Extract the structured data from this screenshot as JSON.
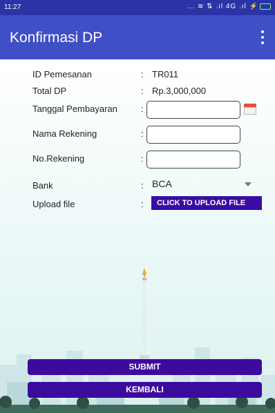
{
  "status_bar": {
    "time": "11:27",
    "icons": "... ≋ ⇅ .ıl 4G .ıl ⚡"
  },
  "app_bar": {
    "title": "Konfirmasi DP"
  },
  "form": {
    "order_id": {
      "label": "ID Pemesanan",
      "value": "TR011"
    },
    "total_dp": {
      "label": "Total DP",
      "value": "Rp.3,000,000"
    },
    "payment_date": {
      "label": "Tanggal Pembayaran",
      "value": ""
    },
    "account_name": {
      "label": "Nama Rekening",
      "value": ""
    },
    "account_number": {
      "label": "No.Rekening",
      "value": ""
    },
    "bank": {
      "label": "Bank",
      "selected": "BCA"
    },
    "upload": {
      "label": "Upload file",
      "button": "CLICK TO UPLOAD FILE"
    },
    "colon": ":"
  },
  "actions": {
    "submit": "SUBMIT",
    "back": "KEMBALI"
  },
  "colors": {
    "app_bar": "#3f4fc6",
    "status_bar": "#2a34a6",
    "button": "#3d0a9e"
  }
}
